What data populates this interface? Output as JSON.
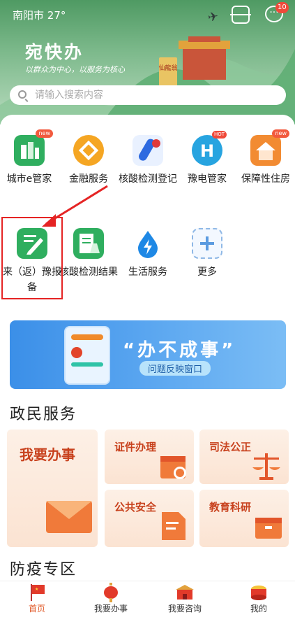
{
  "status": {
    "city": "南阳市",
    "temperature": "27°"
  },
  "header": {
    "app_name": "宛快办",
    "slogan": "以群众为中心，以服务为核心",
    "message_badge": "10",
    "gate_sign": "仙龍翁"
  },
  "search": {
    "placeholder": "请输入搜索内容"
  },
  "services": [
    {
      "label": "城市e管家",
      "icon": "city-e-steward-icon",
      "tag": "new"
    },
    {
      "label": "金融服务",
      "icon": "finance-coin-icon",
      "tag": ""
    },
    {
      "label": "核酸检测登记",
      "icon": "nucleic-test-register-icon",
      "tag": ""
    },
    {
      "label": "豫电管家",
      "icon": "yudian-h-icon",
      "tag": "HOT"
    },
    {
      "label": "保障性住房",
      "icon": "housing-icon",
      "tag": "new"
    },
    {
      "label": "来（返）豫报备",
      "icon": "report-edit-icon",
      "tag": ""
    },
    {
      "label": "核酸检测结果",
      "icon": "test-result-icon",
      "tag": ""
    },
    {
      "label": "生活服务",
      "icon": "life-service-bolt-icon",
      "tag": ""
    },
    {
      "label": "更多",
      "icon": "more-plus-icon",
      "tag": ""
    }
  ],
  "banner": {
    "title": "“办不成事”",
    "subtitle": "问题反映窗口"
  },
  "gov_section": {
    "title": "政民服务",
    "tiles": [
      {
        "label": "我要办事"
      },
      {
        "label": "证件办理"
      },
      {
        "label": "司法公正"
      },
      {
        "label": "公共安全"
      },
      {
        "label": "教育科研"
      }
    ]
  },
  "epidemic_section": {
    "title": "防疫专区"
  },
  "tabs": [
    {
      "label": "首页",
      "active": true
    },
    {
      "label": "我要办事",
      "active": false
    },
    {
      "label": "我要咨询",
      "active": false
    },
    {
      "label": "我的",
      "active": false
    }
  ],
  "colors": {
    "header_green": "#4f9a63",
    "accent_orange": "#e05a2a",
    "banner_blue": "#3b8fe8",
    "annotation_red": "#e52424"
  }
}
